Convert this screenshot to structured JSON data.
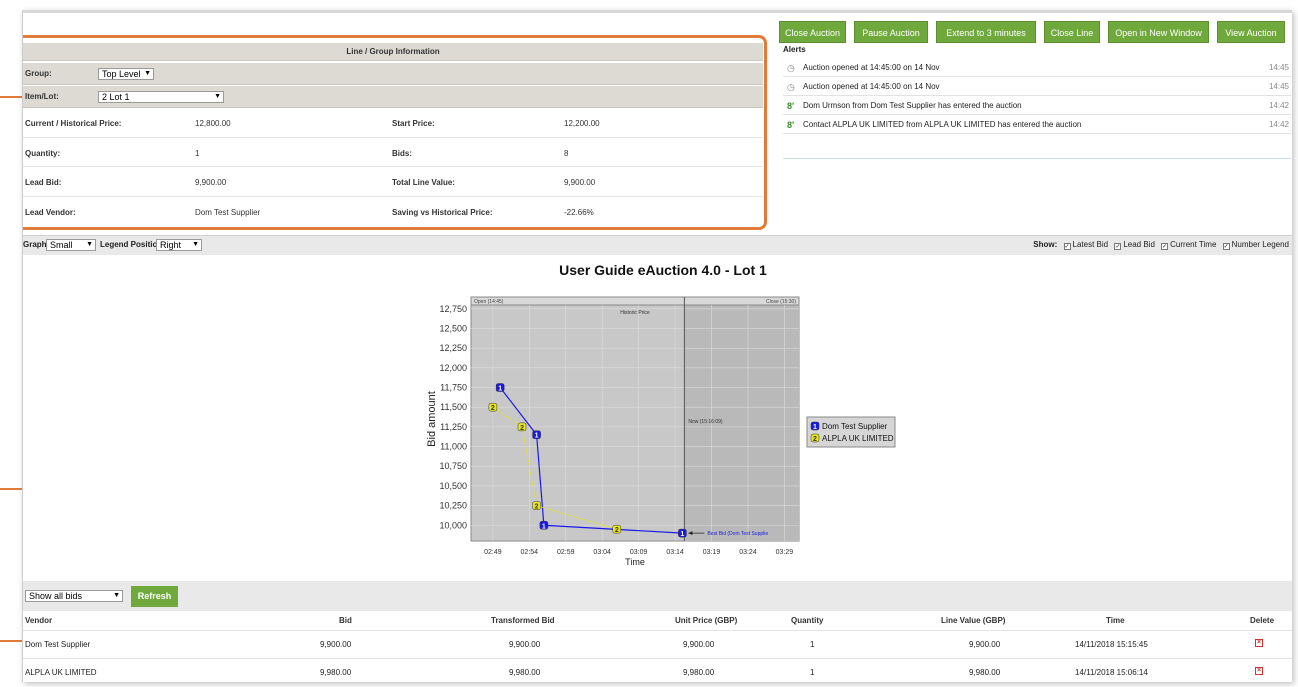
{
  "toolbar": {
    "close_auction": "Close Auction",
    "pause_auction": "Pause Auction",
    "extend": "Extend to 3 minutes",
    "close_line": "Close Line",
    "open_window": "Open in New Window",
    "view_auction": "View Auction"
  },
  "info": {
    "title": "Line / Group Information",
    "group_label": "Group:",
    "group_value": "Top Level",
    "item_label": "Item/Lot:",
    "item_value": "2 Lot 1",
    "current_price_label": "Current / Historical Price:",
    "current_price": "12,800.00",
    "start_price_label": "Start Price:",
    "start_price": "12,200.00",
    "quantity_label": "Quantity:",
    "quantity": "1",
    "bids_label": "Bids:",
    "bids": "8",
    "lead_bid_label": "Lead Bid:",
    "lead_bid": "9,900.00",
    "total_line_label": "Total Line Value:",
    "total_line": "9,900.00",
    "lead_vendor_label": "Lead Vendor:",
    "lead_vendor": "Dom Test Supplier",
    "saving_label": "Saving vs Historical Price:",
    "saving": "-22.66%"
  },
  "alerts": {
    "title": "Alerts",
    "items": [
      {
        "icon": "clock-icon",
        "text": "Auction opened at 14:45:00 on 14 Nov",
        "time": "14:45"
      },
      {
        "icon": "clock-icon",
        "text": "Auction opened at 14:45:00 on 14 Nov",
        "time": "14:45"
      },
      {
        "icon": "user-icon",
        "text": "Dom Urmson from Dom Test Supplier has entered the auction",
        "time": "14:42"
      },
      {
        "icon": "user-icon",
        "text": "Contact ALPLA UK LIMITED from ALPLA UK LIMITED has entered the auction",
        "time": "14:42"
      }
    ]
  },
  "graph_controls": {
    "graph_label": "Graph",
    "graph_value": "Small",
    "legend_label": "Legend Position",
    "legend_value": "Right",
    "show_label": "Show:",
    "latest_bid": "Latest Bid",
    "lead_bid": "Lead Bid",
    "current_time": "Current Time",
    "number_legend": "Number Legend"
  },
  "chart_data": {
    "type": "line",
    "title": "User Guide eAuction 4.0 - Lot 1",
    "xlabel": "Time",
    "ylabel": "Bid amount",
    "x_ticks": [
      "02:49",
      "02:54",
      "02:59",
      "03:04",
      "03:09",
      "03:14",
      "03:19",
      "03:24",
      "03:29"
    ],
    "y_ticks": [
      "12,750",
      "12,500",
      "12,250",
      "12,000",
      "11,750",
      "11,500",
      "11,250",
      "11,000",
      "10,750",
      "10,500",
      "10,250",
      "10,000"
    ],
    "ylim": [
      9800,
      12900
    ],
    "annotations": {
      "open": "Open (14:45)",
      "close": "Close (15:30)",
      "historic": "Historic Price",
      "now": "Now (15:16:09)",
      "best_bid": "Best Bid (Dom Test Supplie"
    },
    "series": [
      {
        "name": "Dom Test Supplier",
        "marker": "1",
        "color": "#1a1ae6",
        "x": [
          "02:50",
          "02:55",
          "02:56",
          "03:15"
        ],
        "values": [
          11750,
          11150,
          10000,
          9900
        ]
      },
      {
        "name": "ALPLA UK LIMITED",
        "marker": "2",
        "color": "#e6e61a",
        "x": [
          "02:49",
          "02:53",
          "02:55",
          "03:06"
        ],
        "values": [
          11500,
          11250,
          10250,
          9950
        ]
      }
    ]
  },
  "bids": {
    "filter_value": "Show all bids",
    "refresh": "Refresh",
    "headers": [
      "Vendor",
      "Bid",
      "Transformed Bid",
      "Unit Price (GBP)",
      "Quantity",
      "Line Value (GBP)",
      "Time",
      "Delete"
    ],
    "rows": [
      [
        "Dom Test Supplier",
        "9,900.00",
        "9,900.00",
        "9,900.00",
        "1",
        "9,900.00",
        "14/11/2018 15:15:45"
      ],
      [
        "ALPLA UK LIMITED",
        "9,980.00",
        "9,980.00",
        "9,980.00",
        "1",
        "9,980.00",
        "14/11/2018 15:06:14"
      ]
    ]
  }
}
